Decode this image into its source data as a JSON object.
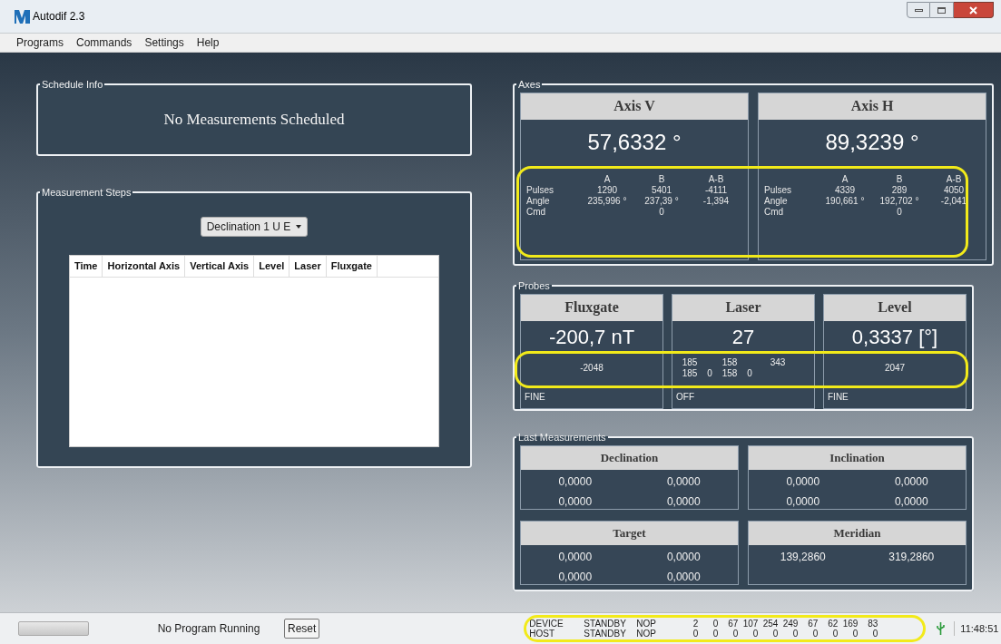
{
  "window": {
    "title": "Autodif 2.3"
  },
  "menu": [
    "Programs",
    "Commands",
    "Settings",
    "Help"
  ],
  "schedule_info": {
    "label": "Schedule Info",
    "message": "No Measurements Scheduled"
  },
  "measurement_steps": {
    "label": "Measurement Steps",
    "dropdown": "Declination 1 U E",
    "columns": [
      "Time",
      "Horizontal Axis",
      "Vertical Axis",
      "Level",
      "Laser",
      "Fluxgate"
    ]
  },
  "axes": {
    "label": "Axes",
    "cards": [
      {
        "title": "Axis V",
        "value": "57,6332 °",
        "columns": [
          "A",
          "B",
          "A-B"
        ],
        "rows": [
          {
            "label": "Pulses",
            "cells": [
              "1290",
              "5401",
              "-4111"
            ]
          },
          {
            "label": "Angle",
            "cells": [
              "235,996 °",
              "237,39 °",
              "-1,394"
            ]
          },
          {
            "label": "Cmd",
            "cells": [
              "",
              "0"
            ]
          }
        ]
      },
      {
        "title": "Axis H",
        "value": "89,3239 °",
        "columns": [
          "A",
          "B",
          "A-B"
        ],
        "rows": [
          {
            "label": "Pulses",
            "cells": [
              "4339",
              "289",
              "4050"
            ]
          },
          {
            "label": "Angle",
            "cells": [
              "190,661 °",
              "192,702 °",
              "-2,041"
            ]
          },
          {
            "label": "Cmd",
            "cells": [
              "",
              "0"
            ]
          }
        ]
      }
    ]
  },
  "probes": {
    "label": "Probes",
    "cards": [
      {
        "title": "Fluxgate",
        "value": "-200,7 nT",
        "rows": [
          [
            "-2048"
          ]
        ],
        "mode": "FINE"
      },
      {
        "title": "Laser",
        "value": "27",
        "rows": [
          [
            "185",
            "",
            "158",
            "",
            "343"
          ],
          [
            "185",
            "0",
            "158",
            "0"
          ]
        ],
        "mode": "OFF"
      },
      {
        "title": "Level",
        "value": "0,3337 [°]",
        "rows": [
          [
            "2047"
          ]
        ],
        "mode": "FINE"
      }
    ]
  },
  "last_measurements": {
    "label": "Last Measurements",
    "cards": [
      {
        "title": "Declination",
        "rows": [
          [
            "0,0000",
            "0,0000"
          ],
          [
            "0,0000",
            "0,0000"
          ]
        ]
      },
      {
        "title": "Inclination",
        "rows": [
          [
            "0,0000",
            "0,0000"
          ],
          [
            "0,0000",
            "0,0000"
          ]
        ]
      },
      {
        "title": "Target",
        "rows": [
          [
            "0,0000",
            "0,0000"
          ],
          [
            "0,0000",
            "0,0000"
          ]
        ]
      },
      {
        "title": "Meridian",
        "rows": [
          [
            "139,2860",
            "319,2860"
          ]
        ]
      }
    ]
  },
  "status_bar": {
    "progress": {
      "level": 0
    },
    "program_status": "No Program Running",
    "reset": "Reset",
    "time": "11:48:51",
    "links": [
      {
        "label": "DEVICE",
        "state": "STANDBY",
        "op": "NOP",
        "values": [
          "2",
          "0",
          "67",
          "107",
          "254",
          "249",
          "67",
          "62",
          "169",
          "83"
        ]
      },
      {
        "label": "HOST",
        "state": "STANDBY",
        "op": "NOP",
        "values": [
          "0",
          "0",
          "0",
          "0",
          "0",
          "0",
          "0",
          "0",
          "0",
          "0"
        ]
      }
    ]
  }
}
